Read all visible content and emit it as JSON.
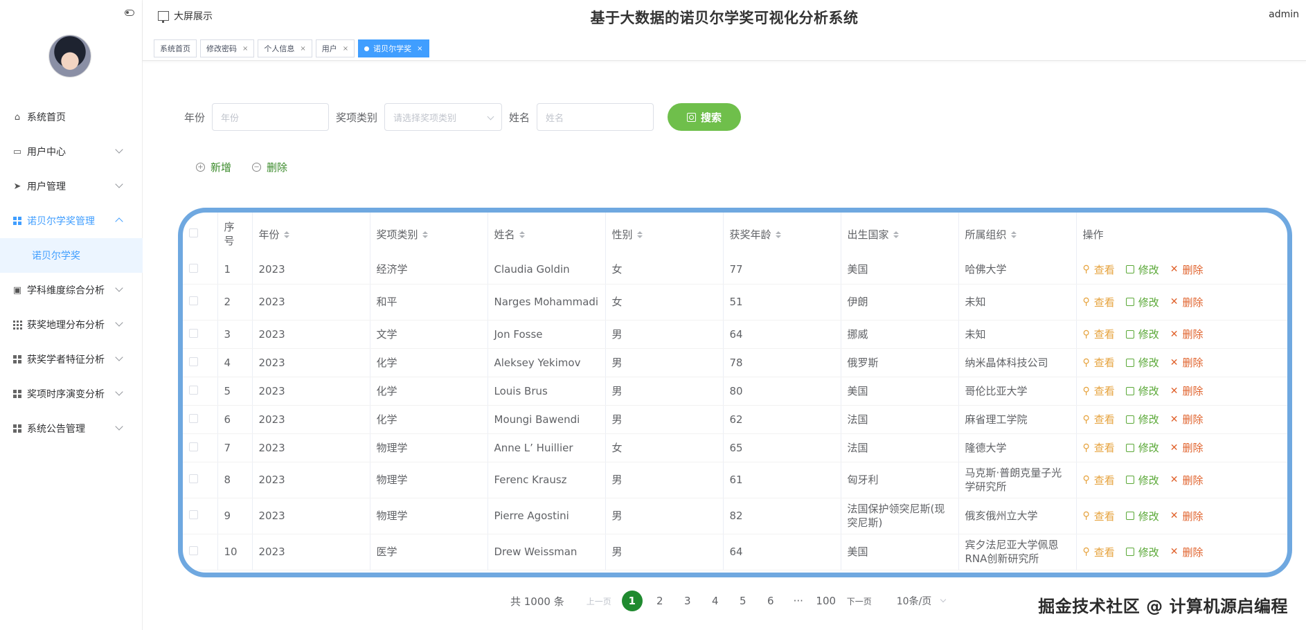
{
  "header": {
    "big_screen_label": "大屏展示",
    "title": "基于大数据的诺贝尔学奖可视化分析系统",
    "user": "admin"
  },
  "tabs": [
    {
      "label": "系统首页",
      "closable": false,
      "active": false
    },
    {
      "label": "修改密码",
      "closable": true,
      "active": false
    },
    {
      "label": "个人信息",
      "closable": true,
      "active": false
    },
    {
      "label": "用户",
      "closable": true,
      "active": false
    },
    {
      "label": "诺贝尔学奖",
      "closable": true,
      "active": true
    }
  ],
  "sidebar": {
    "items": [
      {
        "label": "系统首页",
        "icon": "home-icon"
      },
      {
        "label": "用户中心",
        "icon": "card-icon"
      },
      {
        "label": "用户管理",
        "icon": "send-icon"
      },
      {
        "label": "诺贝尔学奖管理",
        "icon": "grid-icon"
      },
      {
        "label": "诺贝尔学奖",
        "icon": ""
      },
      {
        "label": "学科维度综合分析",
        "icon": "clipboard-icon"
      },
      {
        "label": "获奖地理分布分析",
        "icon": "grid9-icon"
      },
      {
        "label": "获奖学者特征分析",
        "icon": "grid-icon"
      },
      {
        "label": "奖项时序演变分析",
        "icon": "grid-icon"
      },
      {
        "label": "系统公告管理",
        "icon": "grid-icon"
      }
    ]
  },
  "search": {
    "year_label": "年份",
    "year_placeholder": "年份",
    "category_label": "奖项类别",
    "category_placeholder": "请选择奖项类别",
    "name_label": "姓名",
    "name_placeholder": "姓名",
    "button": "搜索"
  },
  "actions": {
    "add": "新增",
    "delete": "删除"
  },
  "table": {
    "headers": [
      "序号",
      "年份",
      "奖项类别",
      "姓名",
      "性别",
      "获奖年龄",
      "出生国家",
      "所属组织",
      "操作"
    ],
    "op_view": "查看",
    "op_edit": "修改",
    "op_delete": "删除",
    "rows": [
      [
        "1",
        "2023",
        "经济学",
        "Claudia Goldin",
        "女",
        "77",
        "美国",
        "哈佛大学"
      ],
      [
        "2",
        "2023",
        "和平",
        "Narges Mohammadi",
        "女",
        "51",
        "伊朗",
        "未知"
      ],
      [
        "3",
        "2023",
        "文学",
        "Jon Fosse",
        "男",
        "64",
        "挪威",
        "未知"
      ],
      [
        "4",
        "2023",
        "化学",
        "Aleksey Yekimov",
        "男",
        "78",
        "俄罗斯",
        "纳米晶体科技公司"
      ],
      [
        "5",
        "2023",
        "化学",
        "Louis Brus",
        "男",
        "80",
        "美国",
        "哥伦比亚大学"
      ],
      [
        "6",
        "2023",
        "化学",
        "Moungi Bawendi",
        "男",
        "62",
        "法国",
        "麻省理工学院"
      ],
      [
        "7",
        "2023",
        "物理学",
        "Anne L’ Huillier",
        "女",
        "65",
        "法国",
        "隆德大学"
      ],
      [
        "8",
        "2023",
        "物理学",
        "Ferenc Krausz",
        "男",
        "61",
        "匈牙利",
        "马克斯·普朗克量子光学研究所"
      ],
      [
        "9",
        "2023",
        "物理学",
        "Pierre Agostini",
        "男",
        "82",
        "法国保护领突尼斯(现突尼斯)",
        "俄亥俄州立大学"
      ],
      [
        "10",
        "2023",
        "医学",
        "Drew Weissman",
        "男",
        "64",
        "美国",
        "宾夕法尼亚大学佩恩RNA创新研究所"
      ]
    ]
  },
  "pagination": {
    "total": "共 1000 条",
    "prev": "上一页",
    "next": "下一页",
    "pages": [
      "1",
      "2",
      "3",
      "4",
      "5",
      "6",
      "···",
      "100"
    ],
    "current": "1",
    "page_size": "10条/页"
  },
  "watermark": "掘金技术社区 @ 计算机源启编程",
  "colors": {
    "primary": "#409eff",
    "search_button": "#6fbf4b",
    "table_border": "#6fa8e0",
    "current_page": "#1f8a2f",
    "view": "#e6a23c",
    "edit": "#5aa837",
    "delete": "#e0622c"
  }
}
